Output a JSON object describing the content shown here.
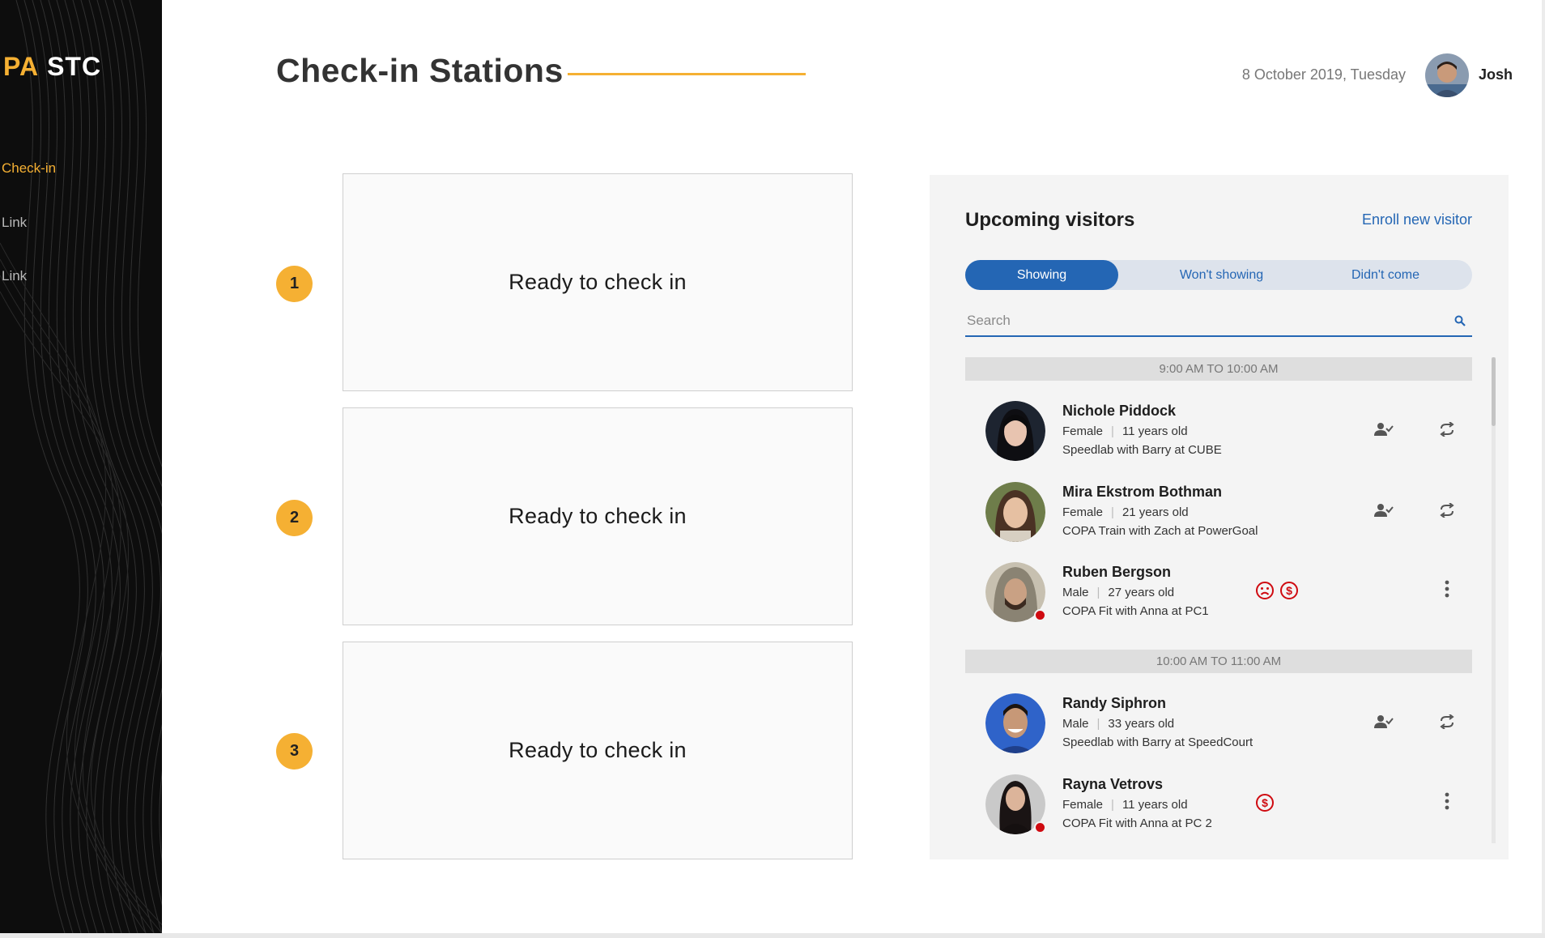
{
  "sidebar": {
    "logo_part1": "PA",
    "logo_part2": "STC",
    "items": [
      {
        "label": "Check-in",
        "active": true
      },
      {
        "label": "Link",
        "active": false
      },
      {
        "label": "Link",
        "active": false
      }
    ]
  },
  "header": {
    "title": "Check-in Stations",
    "date": "8 October 2019, Tuesday",
    "user_name": "Josh"
  },
  "stations": [
    {
      "number": "1",
      "status": "Ready to check in"
    },
    {
      "number": "2",
      "status": "Ready to check in"
    },
    {
      "number": "3",
      "status": "Ready to check in"
    }
  ],
  "visitors_panel": {
    "title": "Upcoming visitors",
    "enroll_label": "Enroll new visitor",
    "tabs": [
      {
        "label": "Showing",
        "active": true
      },
      {
        "label": "Won't showing",
        "active": false
      },
      {
        "label": "Didn't come",
        "active": false
      }
    ],
    "search_placeholder": "Search",
    "slots": [
      {
        "label": "9:00 AM TO 10:00 AM"
      },
      {
        "label": "10:00 AM TO 11:00 AM"
      }
    ],
    "visitors": [
      {
        "name": "Nichole Piddock",
        "gender": "Female",
        "age": "11 years old",
        "session": "Speedlab with Barry at CUBE",
        "flags": [],
        "actions": [
          "check-in-user-icon",
          "refresh-icon"
        ]
      },
      {
        "name": "Mira Ekstrom Bothman",
        "gender": "Female",
        "age": "21 years old",
        "session": "COPA Train with Zach at  PowerGoal",
        "flags": [],
        "actions": [
          "check-in-user-icon",
          "refresh-icon"
        ]
      },
      {
        "name": "Ruben Bergson",
        "gender": "Male",
        "age": "27 years old",
        "session": "COPA Fit with Anna at PC1",
        "flags": [
          "sad-face-icon",
          "dollar-icon"
        ],
        "actions": [
          "more-vertical-icon"
        ]
      },
      {
        "name": "Randy Siphron",
        "gender": "Male",
        "age": "33 years old",
        "session": "Speedlab with Barry at SpeedCourt",
        "flags": [],
        "actions": [
          "check-in-user-icon",
          "refresh-icon"
        ]
      },
      {
        "name": "Rayna Vetrovs",
        "gender": "Female",
        "age": "11 years old",
        "session": "COPA Fit with Anna at PC 2",
        "flags": [
          "dollar-icon"
        ],
        "actions": [
          "more-vertical-icon"
        ]
      }
    ]
  },
  "colors": {
    "accent": "#f5b033",
    "primary_blue": "#2466b4",
    "alert_red": "#cf0a10",
    "sidebar_bg": "#0d0d0d"
  }
}
